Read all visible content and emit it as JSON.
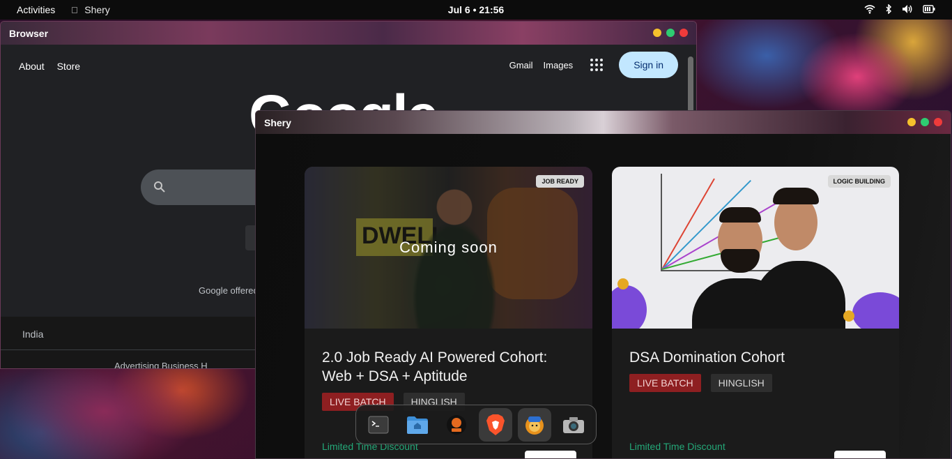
{
  "topbar": {
    "activities": "Activities",
    "app_name": "Shery",
    "clock": "Jul 6 • 21:56",
    "tray_icons": [
      "wifi-icon",
      "bluetooth-icon",
      "volume-icon",
      "battery-icon"
    ]
  },
  "browser": {
    "title": "Browser",
    "nav_left": [
      "About",
      "Store"
    ],
    "nav_right": [
      "Gmail",
      "Images"
    ],
    "sign_in": "Sign in",
    "logo": "Google",
    "offered_in": "Google offered",
    "footer_country": "India",
    "footer_links": "Advertising    Business    H"
  },
  "shery": {
    "title": "Shery",
    "cards": [
      {
        "tag": "JOB READY",
        "overlay": "Coming soon",
        "thumb_text": "DWELL",
        "title": "2.0 Job Ready AI Powered Cohort: Web + DSA + Aptitude",
        "pills": [
          "LIVE BATCH",
          "HINGLISH"
        ],
        "discount": "Limited Time Discount"
      },
      {
        "tag": "LOGIC BUILDING",
        "title": "DSA Domination Cohort",
        "pills": [
          "LIVE BATCH",
          "HINGLISH"
        ],
        "discount": "Limited Time Discount"
      }
    ]
  },
  "dock": {
    "items": [
      "terminal-icon",
      "files-icon",
      "cook-app-icon",
      "brave-browser-icon",
      "lion-app-icon",
      "camera-icon"
    ]
  },
  "colors": {
    "live_pill": "#8e1f21",
    "discount": "#24a878",
    "signin_bg": "#c2e7ff"
  }
}
